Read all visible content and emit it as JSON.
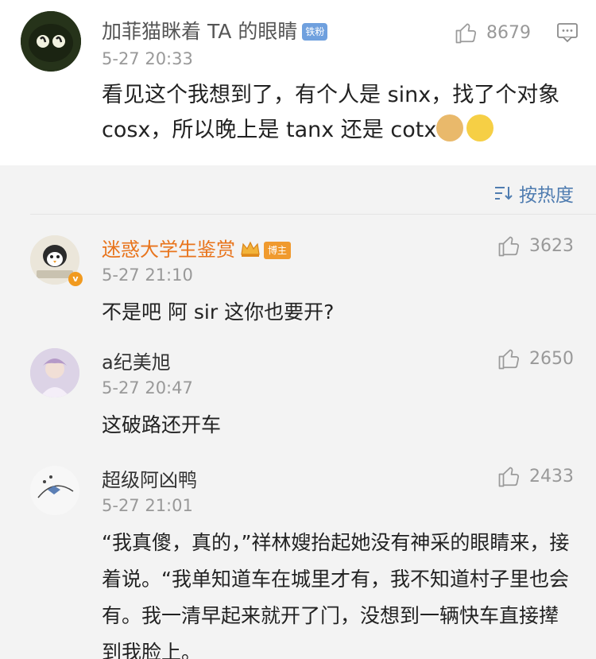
{
  "main_comment": {
    "user": "加菲猫眯着 TA 的眼睛",
    "badge": "铁粉",
    "time": "5-27 20:33",
    "likes": "8679",
    "text": "看见这个我想到了，有个人是 sinx，找了个对象 cosx，所以晚上是 tanx 还是 cotx"
  },
  "sort_label": "按热度",
  "replies": [
    {
      "user": "迷惑大学生鉴赏",
      "badge": "博主",
      "time": "5-27 21:10",
      "likes": "3623",
      "text": "不是吧 阿 sir 这你也要开?"
    },
    {
      "user": "a纪美旭",
      "time": "5-27 20:47",
      "likes": "2650",
      "text": "这破路还开车"
    },
    {
      "user": "超级阿凶鸭",
      "time": "5-27 21:01",
      "likes": "2433",
      "text": "“我真傻，真的，”祥林嫂抬起她没有神采的眼睛来，接着说。“我单知道车在城里才有，我不知道村子里也会有。我一清早起来就开了门，没想到一辆快车直接撵到我脸上。"
    }
  ],
  "colors": {
    "vip_name": "#e8741c",
    "sort_link": "#4f7cb0",
    "fan_badge": "#6fa0de",
    "host_badge": "#f09a2e"
  },
  "icons": [
    "thumbs-up-icon",
    "comment-icon",
    "sort-icon",
    "crown-icon",
    "verified-badge-icon"
  ]
}
